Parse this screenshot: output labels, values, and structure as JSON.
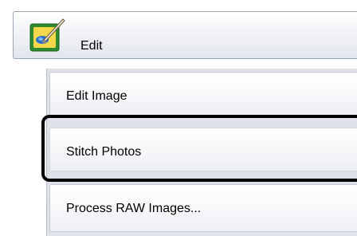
{
  "header": {
    "label": "Edit",
    "icon": "edit-palette-brush-icon"
  },
  "menu": {
    "items": [
      {
        "label": "Edit Image"
      },
      {
        "label": "Stitch Photos"
      },
      {
        "label": "Process RAW Images..."
      }
    ],
    "highlighted_item": "Stitch Photos"
  },
  "colors": {
    "highlight_border": "#000000",
    "header_border": "#9aa6b4",
    "panel_background": "#dfe3e9",
    "icon_frame": "#2f8a2f",
    "icon_canvas": "#f2d84a",
    "icon_brush_tip": "#2a6fd0"
  }
}
